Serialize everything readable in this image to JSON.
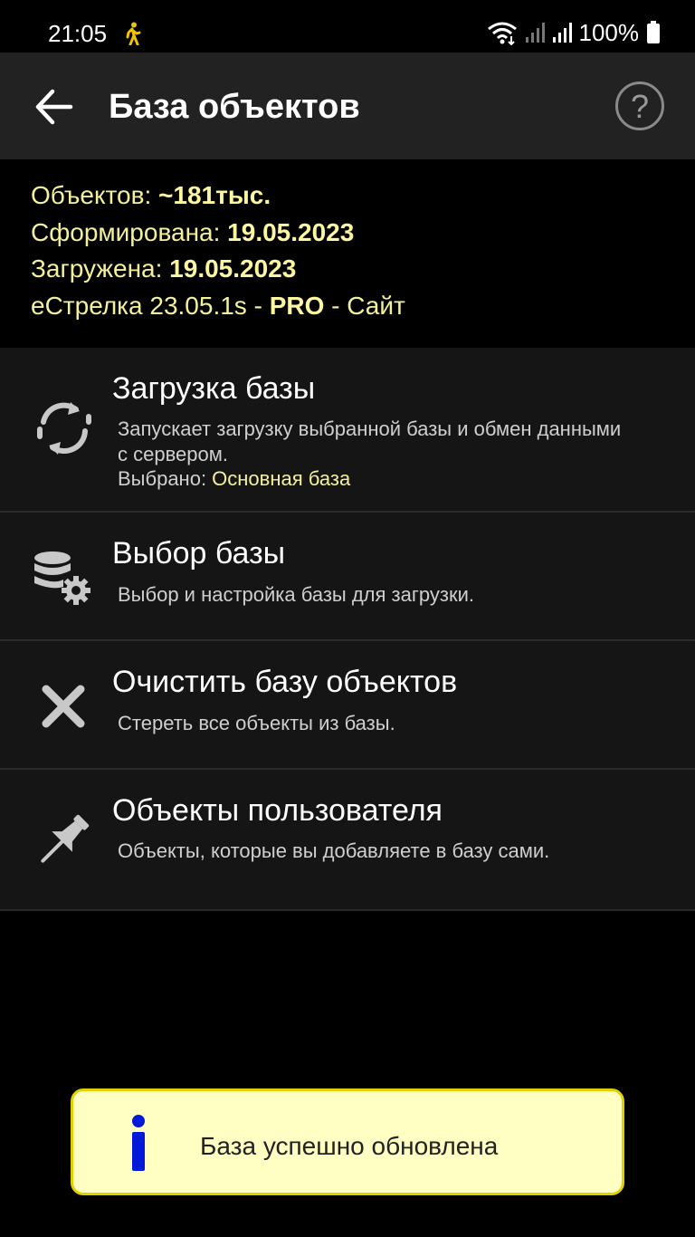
{
  "status_bar": {
    "time": "21:05",
    "battery": "100%",
    "icons": [
      "walking-person-icon",
      "wifi-icon",
      "signal-icon",
      "battery-icon"
    ]
  },
  "app_bar": {
    "title": "База объектов",
    "back_icon": "arrow-left-icon",
    "help_label": "?"
  },
  "info": {
    "objects_label": "Объектов: ",
    "objects_value": "~181тыс.",
    "formed_label": "Сформирована: ",
    "formed_value": "19.05.2023",
    "loaded_label": "Загружена: ",
    "loaded_value": "19.05.2023",
    "version_text": "еСтрелка 23.05.1s - ",
    "pro_label": "PRO",
    "site_text": " - Сайт"
  },
  "menu": [
    {
      "icon": "sync-icon",
      "title": "Загрузка базы",
      "description": "Запускает загрузку выбранной базы и обмен данными с сервером.",
      "selected_label": "Выбрано: ",
      "selected_value": "Основная база"
    },
    {
      "icon": "database-settings-icon",
      "title": "Выбор базы",
      "description": "Выбор и настройка базы для загрузки."
    },
    {
      "icon": "close-icon",
      "title": "Очистить базу объектов",
      "description": "Стереть все объекты из базы."
    },
    {
      "icon": "pushpin-icon",
      "title": "Объекты пользователя",
      "description": "Объекты, которые вы добавляете в базу сами."
    }
  ],
  "toast": {
    "icon": "info-icon",
    "message": "База успешно обновлена"
  },
  "colors": {
    "background": "#000000",
    "app_bar": "#222222",
    "menu_item": "#151515",
    "info_text": "#f4f19a",
    "toast_bg": "#ffffc4",
    "toast_border": "#e3d000",
    "info_icon": "#0018d8"
  }
}
